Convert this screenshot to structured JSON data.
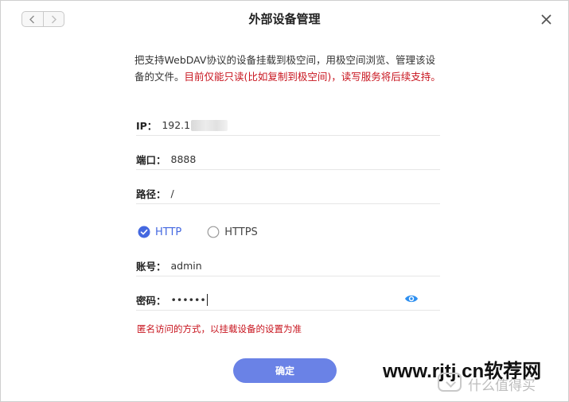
{
  "window": {
    "title": "外部设备管理",
    "close_icon": "close-icon",
    "back_icon": "chevron-left-icon",
    "forward_icon": "chevron-right-icon"
  },
  "description": {
    "text": "把支持WebDAV协议的设备挂载到极空间，用极空间浏览、管理该设备的文件。",
    "warning": "目前仅能只读(比如复制到极空间)，读写服务将后续支持。"
  },
  "form": {
    "ip": {
      "label": "IP：",
      "value": "192.1"
    },
    "port": {
      "label": "端口：",
      "value": "8888"
    },
    "path": {
      "label": "路径：",
      "value": "/"
    },
    "protocol": {
      "options": [
        "HTTP",
        "HTTPS"
      ],
      "selected": "HTTP"
    },
    "account": {
      "label": "账号：",
      "value": "admin"
    },
    "password": {
      "label": "密码：",
      "value": "••••••",
      "toggle_icon": "eye-icon"
    }
  },
  "hint": "匿名访问的方式，以挂载设备的设置为准",
  "confirm_label": "确定",
  "watermark": {
    "site": "www.rjtj.cn软荐网",
    "brand": "什么值得买"
  },
  "colors": {
    "accent": "#6a82e6",
    "radio_selected": "#4468e0",
    "warning": "#c8141e"
  }
}
